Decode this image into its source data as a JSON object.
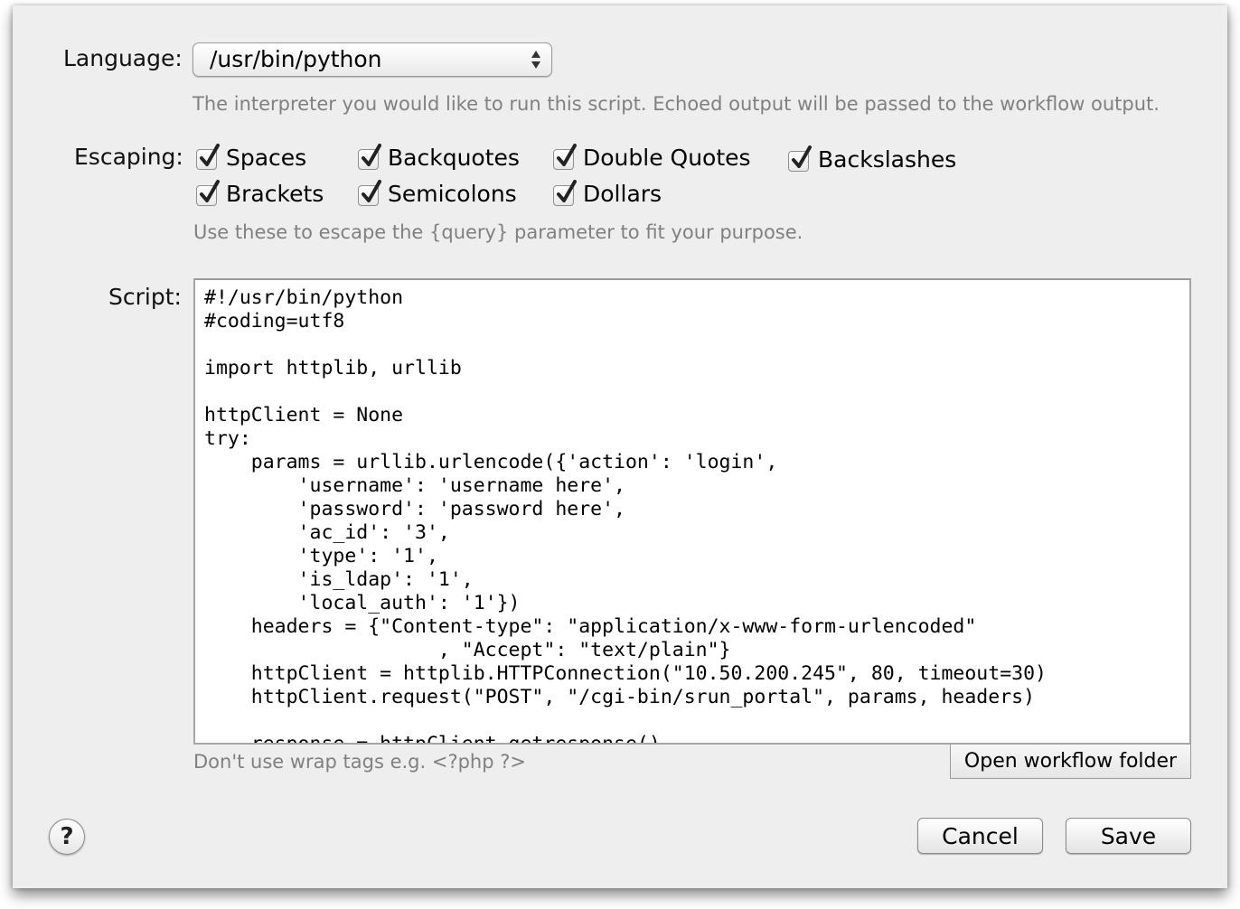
{
  "language": {
    "label": "Language:",
    "selected": "/usr/bin/python",
    "hint": "The interpreter you would like to run this script. Echoed output will be passed to the workflow output."
  },
  "escaping": {
    "label": "Escaping:",
    "options": [
      {
        "label": "Spaces",
        "checked": true
      },
      {
        "label": "Backquotes",
        "checked": true
      },
      {
        "label": "Double Quotes",
        "checked": true
      },
      {
        "label": "Backslashes",
        "checked": true
      },
      {
        "label": "Brackets",
        "checked": true
      },
      {
        "label": "Semicolons",
        "checked": true
      },
      {
        "label": "Dollars",
        "checked": true
      }
    ],
    "hint": "Use these to escape the {query} parameter to fit your purpose."
  },
  "script": {
    "label": "Script:",
    "code": "#!/usr/bin/python\n#coding=utf8\n\nimport httplib, urllib\n\nhttpClient = None\ntry:\n    params = urllib.urlencode({'action': 'login',\n        'username': 'username here',\n        'password': 'password here',\n        'ac_id': '3',\n        'type': '1',\n        'is_ldap': '1',\n        'local_auth': '1'})\n    headers = {\"Content-type\": \"application/x-www-form-urlencoded\"\n                    , \"Accept\": \"text/plain\"}\n    httpClient = httplib.HTTPConnection(\"10.50.200.245\", 80, timeout=30)\n    httpClient.request(\"POST\", \"/cgi-bin/srun_portal\", params, headers)\n\n    response = httpClient.getresponse()",
    "hint": "Don't use wrap tags e.g. <?php ?>",
    "open_folder_label": "Open workflow folder"
  },
  "footer": {
    "help_label": "?",
    "cancel_label": "Cancel",
    "save_label": "Save"
  }
}
